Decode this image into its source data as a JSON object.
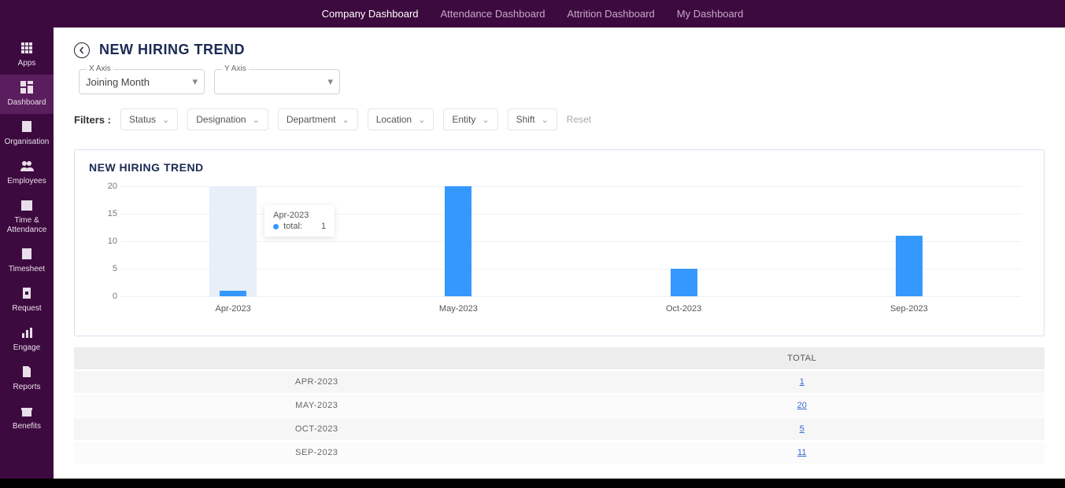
{
  "topTabs": [
    {
      "label": "Company Dashboard",
      "active": true
    },
    {
      "label": "Attendance Dashboard",
      "active": false
    },
    {
      "label": "Attrition Dashboard",
      "active": false
    },
    {
      "label": "My Dashboard",
      "active": false
    }
  ],
  "sidebar": [
    {
      "id": "apps",
      "label": "Apps",
      "icon": "grid"
    },
    {
      "id": "dashboard",
      "label": "Dashboard",
      "icon": "dashboard",
      "active": true
    },
    {
      "id": "organisation",
      "label": "Organisation",
      "icon": "org"
    },
    {
      "id": "employees",
      "label": "Employees",
      "icon": "people"
    },
    {
      "id": "time-attendance",
      "label": "Time & Attendance",
      "icon": "calendar"
    },
    {
      "id": "timesheet",
      "label": "Timesheet",
      "icon": "sheet"
    },
    {
      "id": "request",
      "label": "Request",
      "icon": "doc"
    },
    {
      "id": "engage",
      "label": "Engage",
      "icon": "bars"
    },
    {
      "id": "reports",
      "label": "Reports",
      "icon": "page"
    },
    {
      "id": "benefits",
      "label": "Benefits",
      "icon": "gift"
    }
  ],
  "page": {
    "title": "NEW HIRING TREND",
    "xaxis": {
      "label": "X Axis",
      "value": "Joining Month"
    },
    "yaxis": {
      "label": "Y Axis",
      "value": ""
    }
  },
  "filters": {
    "label": "Filters :",
    "items": [
      "Status",
      "Designation",
      "Department",
      "Location",
      "Entity",
      "Shift"
    ],
    "reset": "Reset"
  },
  "chart_data": {
    "type": "bar",
    "title": "NEW HIRING TREND",
    "categories": [
      "Apr-2023",
      "May-2023",
      "Oct-2023",
      "Sep-2023"
    ],
    "values": [
      1,
      20,
      5,
      11
    ],
    "ylim": [
      0,
      20
    ],
    "yticks": [
      0,
      5,
      10,
      15,
      20
    ],
    "xlabel": "",
    "ylabel": "",
    "highlight_index": 0,
    "tooltip": {
      "category": "Apr-2023",
      "series": "total:",
      "value": 1
    }
  },
  "table": {
    "columns": [
      "",
      "TOTAL"
    ],
    "rows": [
      {
        "cat": "APR-2023",
        "val": 1
      },
      {
        "cat": "MAY-2023",
        "val": 20
      },
      {
        "cat": "OCT-2023",
        "val": 5
      },
      {
        "cat": "SEP-2023",
        "val": 11
      }
    ]
  }
}
